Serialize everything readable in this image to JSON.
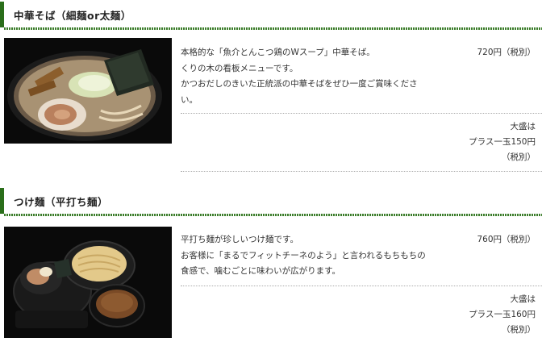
{
  "menu": [
    {
      "title": "中華そば（細麺or太麺）",
      "photo_icon": "ramen-bowl-photo",
      "description_lines": [
        "本格的な「魚介とんこつ鶏のWスープ」中華そば。",
        "くりの木の看板メニューです。",
        "かつおだしのきいた正統派の中華そばをぜひ一度ご賞味くださ",
        "い。"
      ],
      "price": "720円（税別）",
      "large": [
        "大盛は",
        "プラス一玉150円",
        "（税別）"
      ]
    },
    {
      "title": "つけ麺（平打ち麺）",
      "photo_icon": "tsukemen-set-photo",
      "description_lines": [
        "平打ち麺が珍しいつけ麺です。",
        "お客様に「まるでフィットチーネのよう」と言われるもちもちの",
        "食感で、噛むごとに味わいが広がります。"
      ],
      "price": "760円（税別）",
      "large": [
        "大盛は",
        "プラス一玉160円",
        "（税別）"
      ]
    }
  ],
  "colors": {
    "accent": "#2a6e1a",
    "rule": "#3b7d2a"
  }
}
